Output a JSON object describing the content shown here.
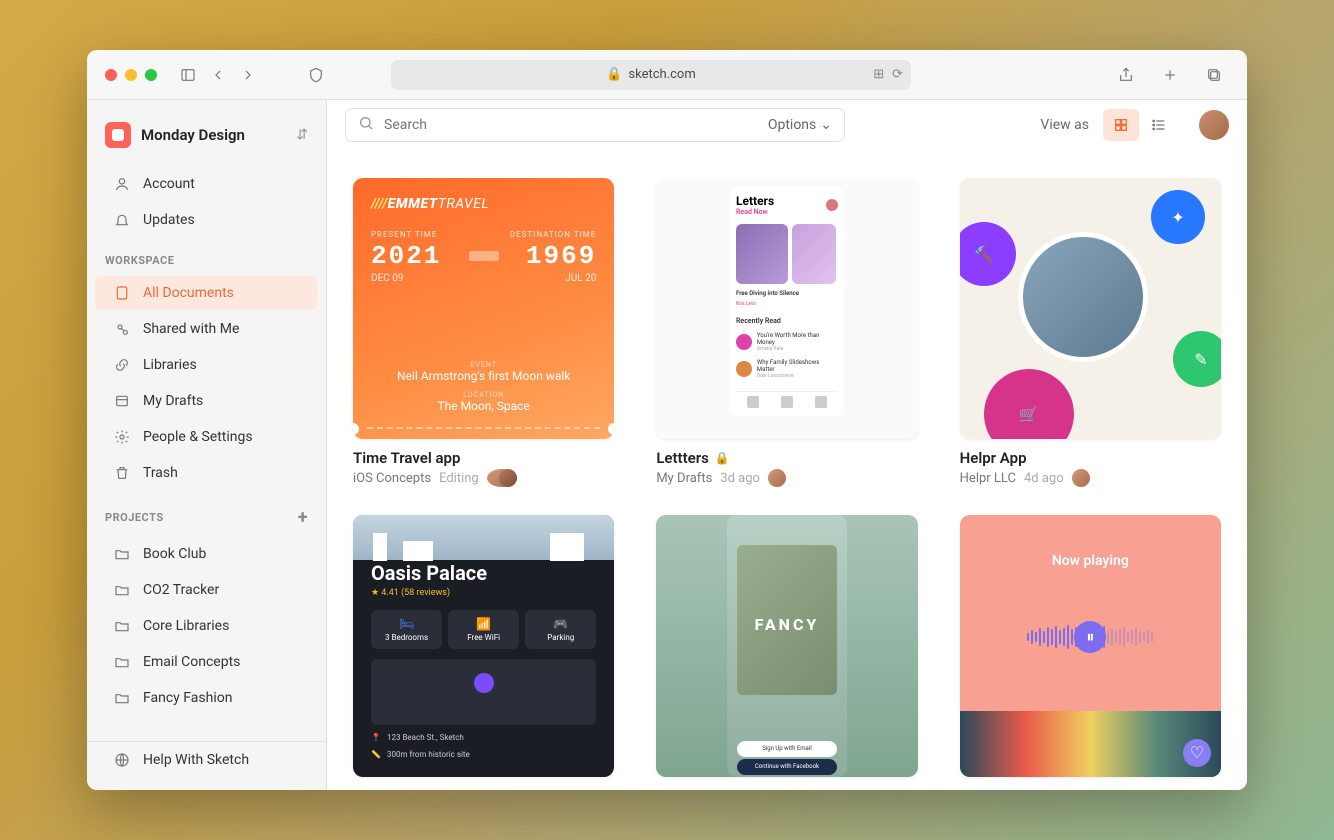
{
  "browser": {
    "url": "sketch.com"
  },
  "workspace": {
    "name": "Monday Design"
  },
  "userNav": [
    {
      "icon": "person",
      "label": "Account"
    },
    {
      "icon": "bell",
      "label": "Updates"
    }
  ],
  "workspaceSection": {
    "label": "WORKSPACE",
    "items": [
      {
        "icon": "doc",
        "label": "All Documents",
        "active": true
      },
      {
        "icon": "share",
        "label": "Shared with Me"
      },
      {
        "icon": "link",
        "label": "Libraries"
      },
      {
        "icon": "drafts",
        "label": "My Drafts"
      },
      {
        "icon": "gear",
        "label": "People & Settings"
      },
      {
        "icon": "trash",
        "label": "Trash"
      }
    ]
  },
  "projectsSection": {
    "label": "PROJECTS",
    "items": [
      {
        "label": "Book Club"
      },
      {
        "label": "CO2 Tracker"
      },
      {
        "label": "Core Libraries"
      },
      {
        "label": "Email Concepts"
      },
      {
        "label": "Fancy Fashion"
      }
    ]
  },
  "helpLink": "Help With Sketch",
  "toolbar": {
    "searchPlaceholder": "Search",
    "optionsLabel": "Options",
    "viewAsLabel": "View as"
  },
  "documents": [
    {
      "title": "Time Travel app",
      "location": "iOS Concepts",
      "status": "Editing",
      "thumb": {
        "brand1": "EMMET",
        "brand2": "TRAVEL",
        "presentLabel": "PRESENT TIME",
        "destLabel": "DESTINATION TIME",
        "year1": "2021",
        "year2": "1969",
        "date1": "DEC 09",
        "date2": "JUL 20",
        "eventLabel": "EVENT",
        "eventVal": "Neil Armstrong's first Moon walk",
        "locLabel": "LOCATION",
        "locVal": "The Moon, Space"
      }
    },
    {
      "title": "Lettters",
      "locked": true,
      "location": "My Drafts",
      "status": "3d ago",
      "thumb": {
        "heading": "Letters",
        "readNow": "Read Now",
        "cap1": "Free Diving into Silence",
        "auth1": "Kira Leto",
        "recent": "Recently Read",
        "li1": "You're Worth More than Money",
        "sub1": "Amelia Kale",
        "li2": "Why Family Slideshows Matter",
        "sub2": "Dale Lansdowne"
      }
    },
    {
      "title": "Helpr App",
      "location": "Helpr LLC",
      "status": "4d ago"
    },
    {
      "thumb": {
        "title": "Oasis Palace",
        "rating": "★ 4.41 (58 reviews)",
        "c1": "3 Bedrooms",
        "c2": "Free WiFi",
        "c3": "Parking",
        "addr": "123 Beach St., Sketch",
        "dist": "300m from historic site"
      }
    },
    {
      "thumb": {
        "brand": "FANCY",
        "btn1": "Sign Up with Email",
        "btn2": "Continue with Facebook"
      }
    },
    {
      "thumb": {
        "nowPlaying": "Now playing"
      }
    }
  ]
}
